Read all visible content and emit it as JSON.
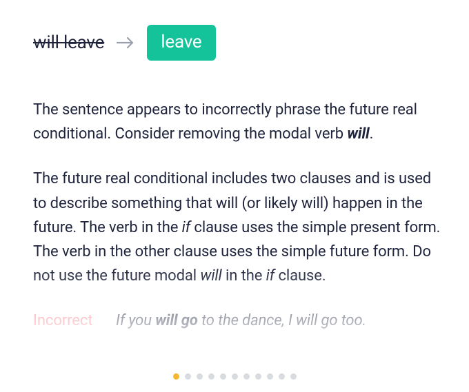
{
  "suggestion": {
    "original": "will leave",
    "replacement": "leave"
  },
  "explanation": {
    "p1_a": "The sentence appears to incorrectly phrase the future real conditional. Consider removing the modal verb ",
    "p1_bi": "will",
    "p1_b": ".",
    "p2_a": "The future real conditional includes two clauses and is used to describe something that will (or likely will) happen in the future. The verb in the ",
    "p2_it1": "if",
    "p2_b": " clause uses the simple present form. The verb in the other clause uses the simple future form. Do not use the future modal ",
    "p2_it2": "will",
    "p2_c": " in the ",
    "p2_it3": "if",
    "p2_d": " clause."
  },
  "example": {
    "label": "Incorrect",
    "a": "If you ",
    "bi": "will go",
    "b": " to the dance, I will go too."
  },
  "pager": {
    "count": 11,
    "active_index": 0
  },
  "colors": {
    "accent": "#15c39a",
    "warn": "#fb7882",
    "dot_active": "#f5b82e",
    "dot": "#d8dbe0"
  }
}
